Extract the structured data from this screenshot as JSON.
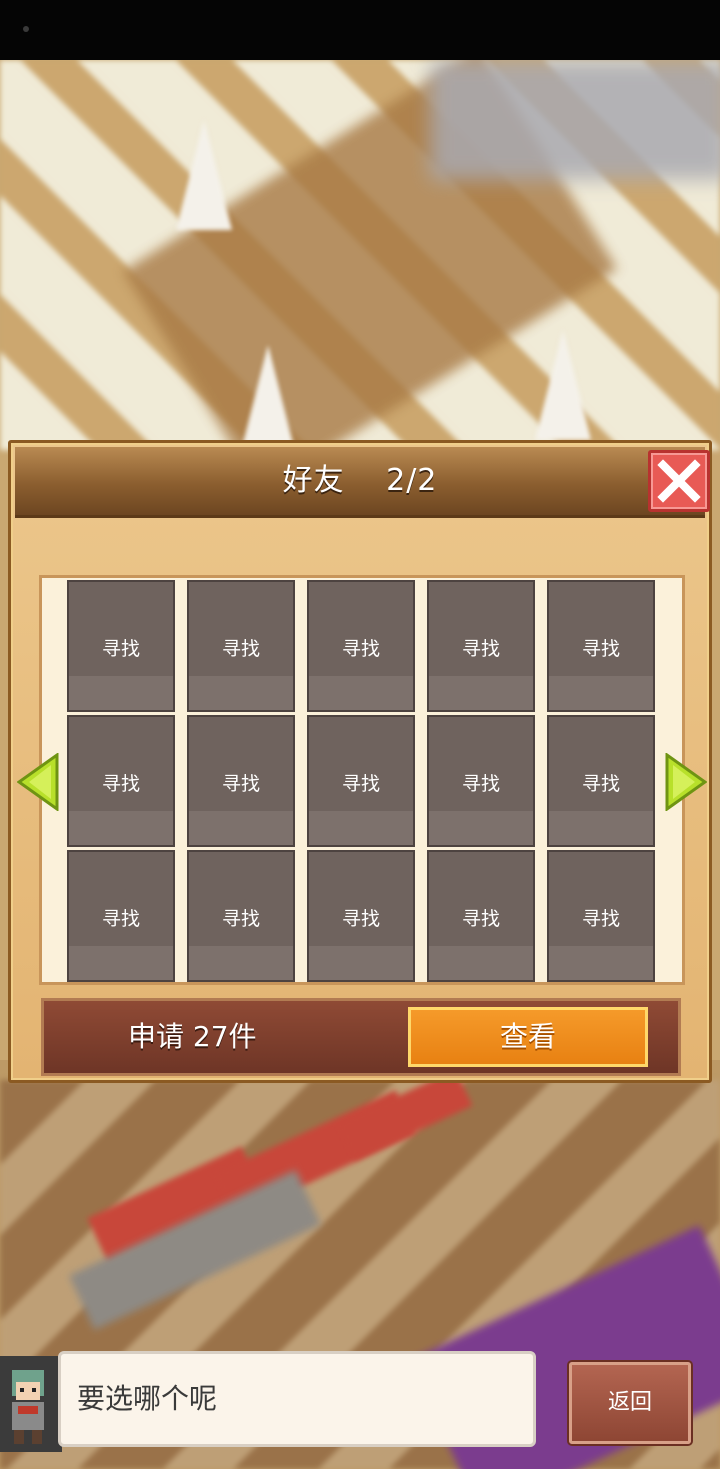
{
  "dialog": {
    "title": "好友　 2/2",
    "friend_slots": [
      {
        "label": "寻找"
      },
      {
        "label": "寻找"
      },
      {
        "label": "寻找"
      },
      {
        "label": "寻找"
      },
      {
        "label": "寻找"
      },
      {
        "label": "寻找"
      },
      {
        "label": "寻找"
      },
      {
        "label": "寻找"
      },
      {
        "label": "寻找"
      },
      {
        "label": "寻找"
      },
      {
        "label": "寻找"
      },
      {
        "label": "寻找"
      },
      {
        "label": "寻找"
      },
      {
        "label": "寻找"
      },
      {
        "label": "寻找"
      }
    ],
    "requests_text": "申请 27件",
    "view_button": "查看",
    "close_icon": "close-x-icon",
    "prev_icon": "arrow-left-icon",
    "next_icon": "arrow-right-icon"
  },
  "message": {
    "text": "要选哪个呢",
    "back_button": "返回"
  },
  "colors": {
    "panel": "#e3b472",
    "slot": "#6f635e",
    "view_button": "#f59a2a",
    "close_button": "#e85a55",
    "arrow": "#b8e02a"
  }
}
